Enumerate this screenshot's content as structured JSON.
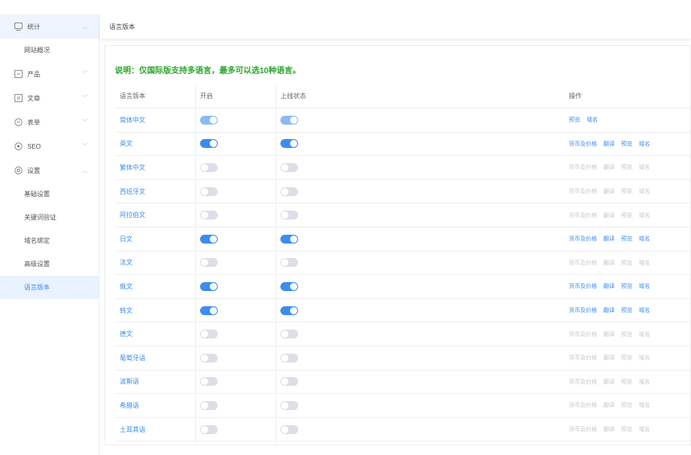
{
  "breadcrumb": "语言版本",
  "sidebar": {
    "items": [
      {
        "label": "统计",
        "icon": "chart-icon",
        "expanded": true
      },
      {
        "label": "网站概况",
        "sub": true
      },
      {
        "label": "产品",
        "icon": "product-icon"
      },
      {
        "label": "文章",
        "icon": "article-icon"
      },
      {
        "label": "表单",
        "icon": "form-icon"
      },
      {
        "label": "SEO",
        "icon": "seo-icon"
      },
      {
        "label": "设置",
        "icon": "settings-icon",
        "expanded": true
      },
      {
        "label": "基础设置",
        "sub": true
      },
      {
        "label": "关键词验证",
        "sub": true
      },
      {
        "label": "域名绑定",
        "sub": true
      },
      {
        "label": "高级设置",
        "sub": true
      },
      {
        "label": "语言版本",
        "sub": true,
        "active": true
      }
    ]
  },
  "main": {
    "notice": "说明：仅国际版支持多语言，最多可以选10种语言。",
    "columns": {
      "name": "语言版本",
      "open": "开启",
      "status": "上线状态",
      "ops": "操作"
    },
    "rows": [
      {
        "name": "简体中文",
        "open": true,
        "status": true,
        "light": true,
        "ops": [
          "预览",
          "域名"
        ],
        "ops_active": true
      },
      {
        "name": "英文",
        "open": true,
        "status": true,
        "ops": [
          "货币及价格",
          "翻译",
          "预览",
          "域名"
        ],
        "ops_active": true
      },
      {
        "name": "繁体中文",
        "open": false,
        "status": false,
        "ops": [
          "货币及价格",
          "翻译",
          "预览",
          "域名"
        ],
        "ops_active": false
      },
      {
        "name": "西班牙文",
        "open": false,
        "status": false,
        "ops": [
          "货币及价格",
          "翻译",
          "预览",
          "域名"
        ],
        "ops_active": false
      },
      {
        "name": "阿拉伯文",
        "open": false,
        "status": false,
        "ops": [
          "货币及价格",
          "翻译",
          "预览",
          "域名"
        ],
        "ops_active": false
      },
      {
        "name": "日文",
        "open": true,
        "status": true,
        "ops": [
          "货币及价格",
          "翻译",
          "预览",
          "域名"
        ],
        "ops_active": true
      },
      {
        "name": "法文",
        "open": false,
        "status": false,
        "ops": [
          "货币及价格",
          "翻译",
          "预览",
          "域名"
        ],
        "ops_active": false
      },
      {
        "name": "俄文",
        "open": true,
        "status": true,
        "ops": [
          "货币及价格",
          "翻译",
          "预览",
          "域名"
        ],
        "ops_active": true
      },
      {
        "name": "韩文",
        "open": true,
        "status": true,
        "ops": [
          "货币及价格",
          "翻译",
          "预览",
          "域名"
        ],
        "ops_active": true
      },
      {
        "name": "德文",
        "open": false,
        "status": false,
        "ops": [
          "货币及价格",
          "翻译",
          "预览",
          "域名"
        ],
        "ops_active": false
      },
      {
        "name": "葡萄牙语",
        "open": false,
        "status": false,
        "ops": [
          "货币及价格",
          "翻译",
          "预览",
          "域名"
        ],
        "ops_active": false
      },
      {
        "name": "波斯语",
        "open": false,
        "status": false,
        "ops": [
          "货币及价格",
          "翻译",
          "预览",
          "域名"
        ],
        "ops_active": false
      },
      {
        "name": "希腊语",
        "open": false,
        "status": false,
        "ops": [
          "货币及价格",
          "翻译",
          "预览",
          "域名"
        ],
        "ops_active": false
      },
      {
        "name": "土耳其语",
        "open": false,
        "status": false,
        "ops": [
          "货币及价格",
          "翻译",
          "预览",
          "域名"
        ],
        "ops_active": false
      }
    ]
  },
  "colors": {
    "accent": "#3b8df0",
    "notice": "#2da62d",
    "toggle_off": "#dcdfe6"
  }
}
